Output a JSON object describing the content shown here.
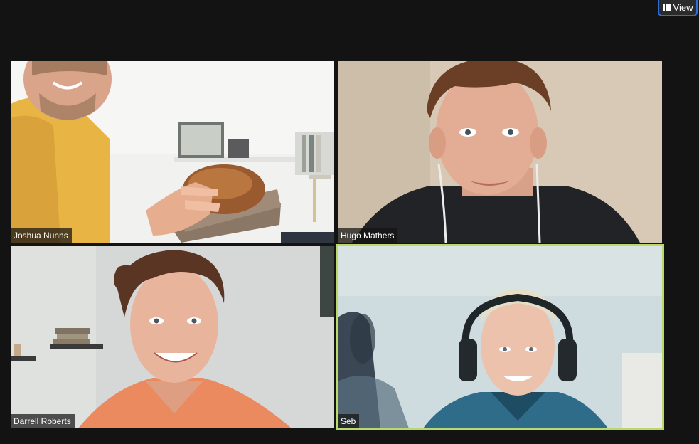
{
  "toolbar": {
    "view_label": "View",
    "view_icon": "grid-icon"
  },
  "participants": [
    {
      "name": "Joshua Nunns",
      "active_speaker": false
    },
    {
      "name": "Hugo Mathers",
      "active_speaker": false
    },
    {
      "name": "Darrell Roberts",
      "active_speaker": false
    },
    {
      "name": "Seb",
      "active_speaker": true
    }
  ],
  "colors": {
    "background": "#131313",
    "active_speaker_border": "#b9d96a",
    "view_button_border": "#2d6fd6"
  }
}
